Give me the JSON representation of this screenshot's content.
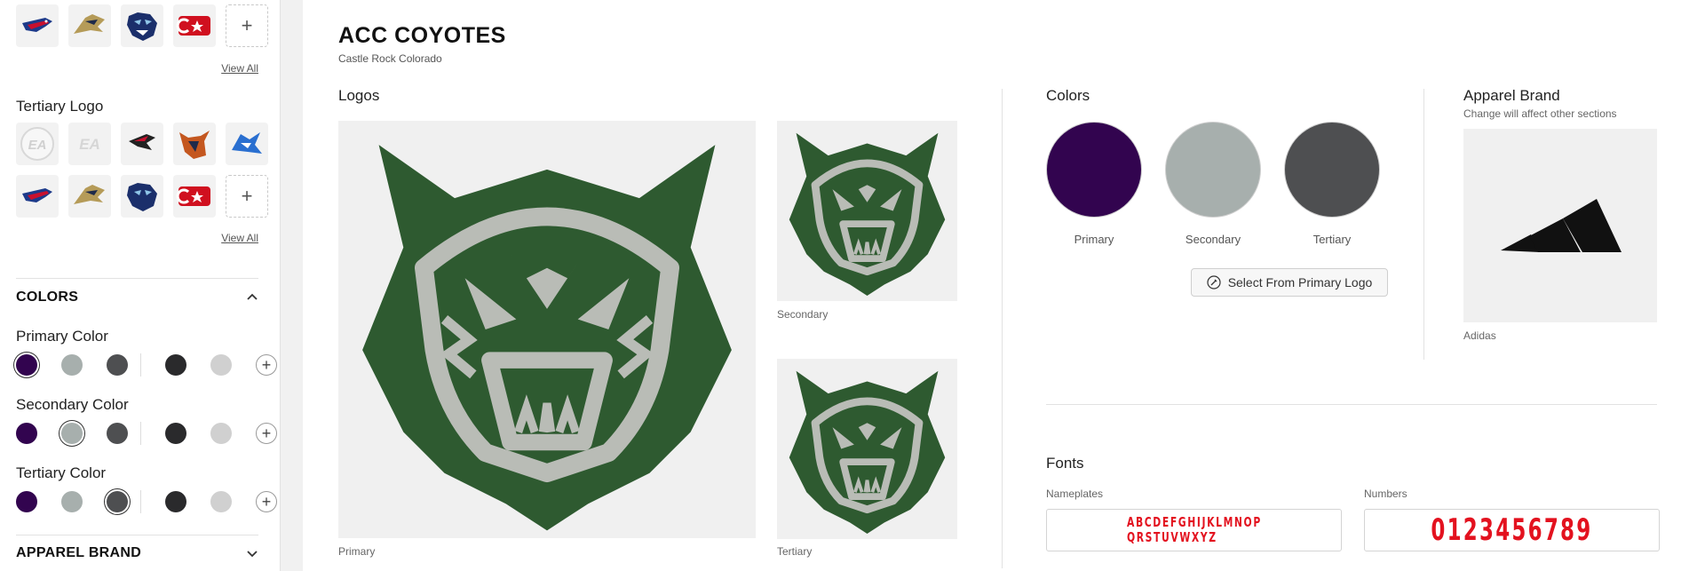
{
  "sidebar": {
    "view_all_label": "View All",
    "tertiary_logo_label": "Tertiary Logo",
    "colors_section": {
      "title": "COLORS"
    },
    "primary_color_label": "Primary Color",
    "secondary_color_label": "Secondary Color",
    "tertiary_color_label": "Tertiary Color",
    "apparel_section": {
      "title": "APPAREL BRAND"
    },
    "swatch_colors": [
      "#32044f",
      "#a7afad",
      "#4e4f51",
      "#2a2a2c",
      "#d0d0d0"
    ],
    "selected_indices": {
      "primary": 0,
      "secondary": 1,
      "tertiary": 2
    },
    "logo_icons": [
      "eagle-logo-icon",
      "wolf-logo-icon",
      "panther-logo-icon",
      "star-c-logo-icon",
      "ea-logo-icon",
      "ea-logo-icon",
      "bird-logo-icon",
      "horns-logo-icon",
      "dragon-logo-icon"
    ]
  },
  "main": {
    "team_name": "ACC COYOTES",
    "team_location": "Castle Rock Colorado",
    "logos_label": "Logos",
    "primary_logo_label": "Primary",
    "secondary_logo_label": "Secondary",
    "tertiary_logo_label": "Tertiary",
    "colors_label": "Colors",
    "colors": [
      {
        "name": "Primary",
        "hex": "#32044f"
      },
      {
        "name": "Secondary",
        "hex": "#a7afad"
      },
      {
        "name": "Tertiary",
        "hex": "#4e4f51"
      }
    ],
    "select_from_logo_label": "Select From Primary Logo",
    "apparel_brand_label": "Apparel Brand",
    "apparel_brand_note": "Change will affect other sections",
    "apparel_brand_name": "Adidas",
    "fonts_label": "Fonts",
    "nameplates_label": "Nameplates",
    "numbers_label": "Numbers",
    "nameplate_sample_line1": "ABCDEFGHIJKLMNOP",
    "nameplate_sample_line2": "QRSTUVWXYZ",
    "numbers_sample": "0123456789",
    "logo_colors": {
      "green": "#2e5a30",
      "gray": "#b9bcb6"
    }
  }
}
